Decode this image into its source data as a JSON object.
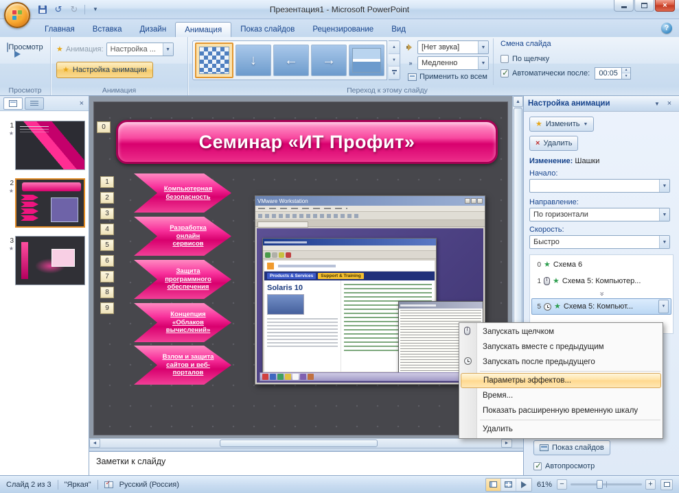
{
  "window": {
    "title": "Презентация1 - Microsoft PowerPoint"
  },
  "tabs": {
    "items": [
      "Главная",
      "Вставка",
      "Дизайн",
      "Анимация",
      "Показ слайдов",
      "Рецензирование",
      "Вид"
    ]
  },
  "ribbon": {
    "preview": {
      "button": "Просмотр",
      "group": "Просмотр"
    },
    "animation": {
      "label": "Анимация:",
      "combo_value": "Настройка ...",
      "custom_button": "Настройка анимации",
      "group": "Анимация"
    },
    "transition": {
      "sound_value": "[Нет звука]",
      "speed_value": "Медленно",
      "apply_all": "Применить ко всем",
      "group": "Переход к этому слайду"
    },
    "advance": {
      "title": "Смена слайда",
      "on_click": "По щелчку",
      "auto_label": "Автоматически после:",
      "auto_time": "00:05"
    }
  },
  "slides_panel": {
    "thumbnails": [
      {
        "num": "1"
      },
      {
        "num": "2"
      },
      {
        "num": "3"
      }
    ]
  },
  "slide": {
    "title": "Семинар «ИТ Профит»",
    "tags": [
      "0",
      "1",
      "2",
      "3",
      "4",
      "5",
      "6",
      "7",
      "8",
      "9"
    ],
    "arrows": [
      "Компьютерная безопасность",
      "Разработка онлайн сервисов",
      "Защита программного обеспечения",
      "Концепция «Облаков вычислений»",
      "Взлом и защита сайтов и веб-порталов"
    ],
    "screenshot": {
      "window_title": "VMware Workstation",
      "page_heading": "Solaris 10",
      "nav_products": "Products & Services",
      "nav_support": "Support & Training"
    }
  },
  "task_pane": {
    "title": "Настройка анимации",
    "change_button": "Изменить",
    "remove_button": "Удалить",
    "modify_label": "Изменение:",
    "modify_value": "Шашки",
    "start_label": "Начало:",
    "start_value": "",
    "direction_label": "Направление:",
    "direction_value": "По горизонтали",
    "speed_label": "Скорость:",
    "speed_value": "Быстро",
    "list": [
      {
        "num": "0",
        "label": "Схема 6"
      },
      {
        "num": "1",
        "label": "Схема 5: Компьютер..."
      },
      {
        "num": "5",
        "label": "Схема 5: Компьют..."
      }
    ],
    "slideshow_button": "Показ слайдов",
    "autopreview_label": "Автопросмотр"
  },
  "context_menu": {
    "items": [
      {
        "label": "Запускать щелчком"
      },
      {
        "label": "Запускать вместе с предыдущим"
      },
      {
        "label": "Запускать после предыдущего"
      },
      {
        "label": "Параметры эффектов..."
      },
      {
        "label": "Время..."
      },
      {
        "label": "Показать расширенную временную шкалу"
      },
      {
        "label": "Удалить"
      }
    ]
  },
  "notes": {
    "placeholder": "Заметки к слайду"
  },
  "status_bar": {
    "slide_info": "Слайд 2 из 3",
    "theme": "\"Яркая\"",
    "language": "Русский (Россия)",
    "zoom": "61%"
  }
}
